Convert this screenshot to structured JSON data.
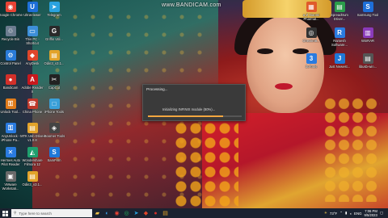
{
  "watermark": "www.BANDICAM.com",
  "desktop_icons": [
    {
      "label": "Google Chrome",
      "color": "#e84335",
      "glyph": "◉"
    },
    {
      "label": "UltraViewer",
      "color": "#1e6fd8",
      "glyph": "U"
    },
    {
      "label": "Telegram",
      "color": "#2aa3e0",
      "glyph": "➤"
    },
    {
      "label": "Recycle Bin",
      "color": "#6b7c8f",
      "glyph": "♲"
    },
    {
      "label": "This PC - Shortcut",
      "color": "#3d8fd8",
      "glyph": "▭"
    },
    {
      "label": "Griffin Util...",
      "color": "#2a2a2a",
      "glyph": "G"
    },
    {
      "label": "Control Panel",
      "color": "#2a7bd8",
      "glyph": "⚙"
    },
    {
      "label": "AnyDesk",
      "color": "#e0462a",
      "glyph": "◆"
    },
    {
      "label": "Odin3_v3.1...",
      "color": "#e2a32a",
      "glyph": "▤"
    },
    {
      "label": "Bandicam",
      "color": "#d2302a",
      "glyph": "●"
    },
    {
      "label": "Adobe Reader X",
      "color": "#c8191d",
      "glyph": "A"
    },
    {
      "label": "CapCut",
      "color": "#222",
      "glyph": "✂"
    },
    {
      "label": "Unlock Tool...",
      "color": "#e07c1a",
      "glyph": "⚿"
    },
    {
      "label": "China Phone",
      "color": "#c0392b",
      "glyph": "☎"
    },
    {
      "label": "iPhone Tools",
      "color": "#3aa0d8",
      "glyph": "□"
    },
    {
      "label": "AnyUnlock - iPhone Pa...",
      "color": "#2a7be0",
      "glyph": "⚿"
    },
    {
      "label": "MTK Usb Driver v1.0.8",
      "color": "#e2a32a",
      "glyph": "▤"
    },
    {
      "label": "iBoomer Tools",
      "color": "#444",
      "glyph": "◈"
    },
    {
      "label": "Hermes Auto Pilot Reader",
      "color": "#2a7be0",
      "glyph": "✕"
    },
    {
      "label": "Wondershare Filmora 12",
      "color": "#1fa06e",
      "glyph": "◭"
    },
    {
      "label": "SamFirm",
      "color": "#1e78d8",
      "glyph": "S"
    },
    {
      "label": "VMware Workstati...",
      "color": "#6a6a6a",
      "glyph": "▣"
    },
    {
      "label": "Odin3_v3.1...",
      "color": "#e2a32a",
      "glyph": "▤"
    }
  ],
  "right_icons": [
    {
      "label": "a-Z Xiaomi Pharmal...",
      "color": "#e05a2a",
      "glyph": "▦"
    },
    {
      "label": "Spreadtrum Driver...",
      "color": "#2a9d4a",
      "glyph": "▤"
    },
    {
      "label": "Samsung Tool",
      "color": "#1e6fd8",
      "glyph": "S"
    },
    {
      "label": "Checkm8...",
      "color": "#333",
      "glyph": "◎"
    },
    {
      "label": "Ramesh Software...",
      "color": "#2a7be0",
      "glyph": "R"
    },
    {
      "label": "WinRAR",
      "color": "#8a3ab9",
      "glyph": "▥"
    },
    {
      "label": "3uTools",
      "color": "#2a7be0",
      "glyph": "3"
    },
    {
      "label": "Just Newest...",
      "color": "#1e78d8",
      "glyph": "J"
    },
    {
      "label": "libusb-win...",
      "color": "#555",
      "glyph": "▤"
    }
  ],
  "dialog": {
    "title": "Processing...",
    "message": "Initializing INFINIX module (80%)...",
    "progress": 0.8
  },
  "taskbar": {
    "search_placeholder": "Type here to search",
    "weather": "73°F",
    "language": "ENG",
    "time": "7:06 PM",
    "date": "9/5/2023"
  }
}
